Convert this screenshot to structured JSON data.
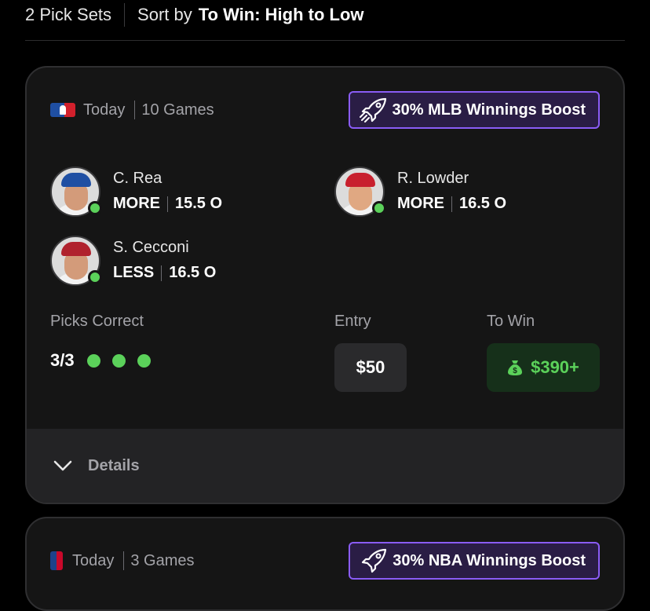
{
  "header": {
    "pick_sets_count": "2 Pick Sets",
    "sort_label": "Sort by",
    "sort_value": "To Win: High to Low"
  },
  "cards": [
    {
      "league_icon": "mlb-logo-icon",
      "when": "Today",
      "games": "10 Games",
      "boost_icon": "rocket-icon",
      "boost_label": "30% MLB Winnings Boost",
      "players": [
        {
          "name": "C. Rea",
          "direction": "MORE",
          "line": "15.5 O",
          "status": "hit"
        },
        {
          "name": "R. Lowder",
          "direction": "MORE",
          "line": "16.5 O",
          "status": "hit"
        },
        {
          "name": "S. Cecconi",
          "direction": "LESS",
          "line": "16.5 O",
          "status": "hit"
        }
      ],
      "picks_correct_label": "Picks Correct",
      "picks_correct_value": "3/3",
      "picks_correct_count": 3,
      "entry_label": "Entry",
      "entry_value": "$50",
      "to_win_label": "To Win",
      "to_win_icon": "money-bag-icon",
      "to_win_value": "$390+",
      "details_label": "Details"
    },
    {
      "league_icon": "nba-logo-icon",
      "when": "Today",
      "games": "3 Games",
      "boost_icon": "rocket-icon",
      "boost_label": "30% NBA Winnings Boost"
    }
  ],
  "colors": {
    "background": "#000000",
    "card": "#151515",
    "boost_border": "#8a5cf6",
    "success_green": "#5bd15a",
    "win_bg": "#16301a"
  }
}
